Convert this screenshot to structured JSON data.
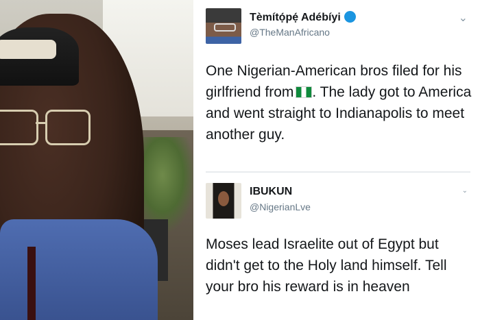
{
  "photo": {
    "subject": "man-selfie"
  },
  "tweet1": {
    "name": "Tèmítọ́pẹ́ Adébíyi",
    "handle": "@TheManAfricano",
    "text_before_flag": "One  Nigerian-American bros filed for his girlfriend from",
    "flag": "nigeria-flag",
    "text_after_flag": ". The lady got to America and went straight to Indianapolis to meet another guy.",
    "menu_icon": "chevron-down-icon"
  },
  "tweet2": {
    "name": "IBUKUN",
    "handle": "@NigerianLve",
    "text": "Moses lead Israelite out of Egypt but didn't get to the Holy land himself. Tell your bro his reward is in heaven",
    "menu_icon": "chevron-down-icon"
  },
  "colors": {
    "name": "#14171a",
    "handle": "#657786",
    "verified": "#1b95e0",
    "divider": "#e8ebee"
  }
}
